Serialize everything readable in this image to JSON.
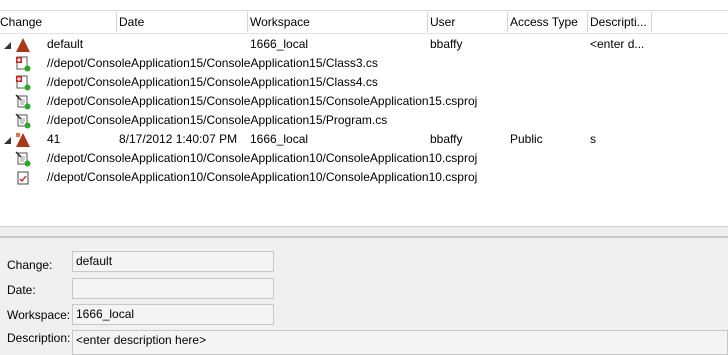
{
  "columns": [
    {
      "key": "change",
      "label": "Change"
    },
    {
      "key": "date",
      "label": "Date"
    },
    {
      "key": "workspace",
      "label": "Workspace"
    },
    {
      "key": "user",
      "label": "User"
    },
    {
      "key": "access",
      "label": "Access Type"
    },
    {
      "key": "description",
      "label": "Descripti..."
    }
  ],
  "changelists": [
    {
      "change": "default",
      "date": "",
      "workspace": "1666_local",
      "user": "bbaffy",
      "access": "",
      "description": "<enter d...",
      "files": [
        {
          "path": "//depot/ConsoleApplication15/ConsoleApplication15/Class3.cs",
          "icon": "file-add-icon"
        },
        {
          "path": "//depot/ConsoleApplication15/ConsoleApplication15/Class4.cs",
          "icon": "file-add-icon"
        },
        {
          "path": "//depot/ConsoleApplication15/ConsoleApplication15/ConsoleApplication15.csproj",
          "icon": "file-edit-icon"
        },
        {
          "path": "//depot/ConsoleApplication15/ConsoleApplication15/Program.cs",
          "icon": "file-edit-icon"
        }
      ]
    },
    {
      "change": "41",
      "date": "8/17/2012 1:40:07 PM",
      "workspace": "1666_local",
      "user": "bbaffy",
      "access": "Public",
      "description": "s",
      "files": [
        {
          "path": "//depot/ConsoleApplication10/ConsoleApplication10/ConsoleApplication10.csproj",
          "icon": "file-edit-icon"
        },
        {
          "path": "//depot/ConsoleApplication10/ConsoleApplication10/ConsoleApplication10.csproj",
          "icon": "file-checked-icon"
        }
      ]
    }
  ],
  "details": {
    "change_label": "Change:",
    "change_value": "default",
    "date_label": "Date:",
    "date_value": "",
    "workspace_label": "Workspace:",
    "workspace_value": "1666_local",
    "description_label": "Description:",
    "description_value": "<enter description here>"
  },
  "colors": {
    "changelist_icon": "#a83a1a",
    "added_badge": "#cc2222",
    "status_dot": "#2aa62a"
  }
}
